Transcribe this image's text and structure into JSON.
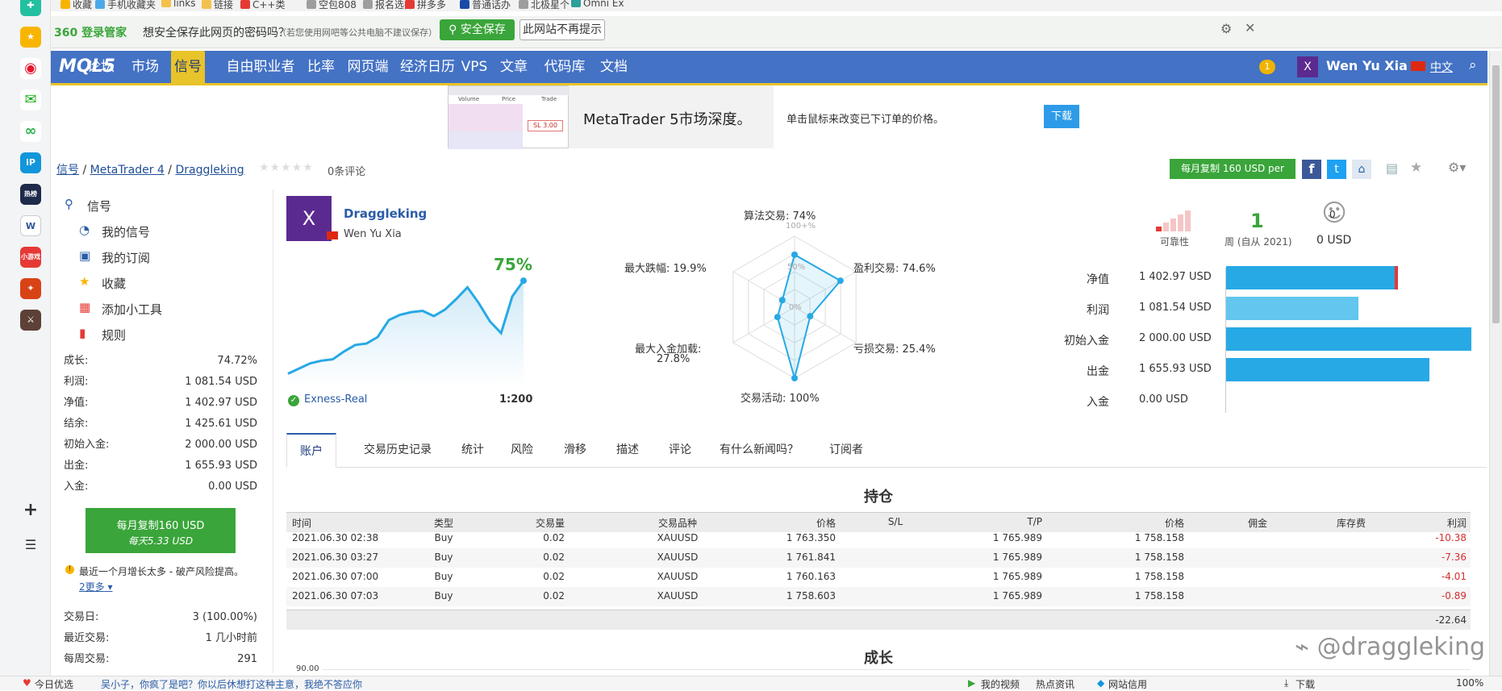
{
  "bookmarks": [
    {
      "label": "收藏",
      "color": "#f6b400"
    },
    {
      "label": "手机收藏夹",
      "color": "#4ba9e8"
    },
    {
      "label": "links",
      "color": "#f3c14b"
    },
    {
      "label": "链接",
      "color": "#f3c14b"
    },
    {
      "label": "C++类",
      "color": "#e53935"
    },
    {
      "label": "空包808",
      "color": "#9e9e9e"
    },
    {
      "label": "报名选择",
      "color": "#9e9e9e"
    },
    {
      "label": "拼多多",
      "color": "#e53935"
    },
    {
      "label": "普通话办",
      "color": "#1a4aa8"
    },
    {
      "label": "北极星个",
      "color": "#9e9e9e"
    },
    {
      "label": "Omni Ex",
      "color": "#2aa198"
    }
  ],
  "savebar": {
    "brand": "360 登录管家",
    "question": "想安全保存此网页的密码吗？",
    "note": "（若您使用网吧等公共电脑不建议保存）",
    "save_button": "安全保存",
    "never_button": "此网站不再提示"
  },
  "nav": {
    "logo": "MQL5",
    "items": [
      "论坛",
      "市场",
      "信号",
      "自由职业者",
      "比率",
      "网页端",
      "经济日历",
      "VPS",
      "文章",
      "代码库",
      "文档"
    ],
    "active": "信号",
    "badge": "1",
    "avatar": "X",
    "user": "Wen Yu Xia",
    "lang": "中文"
  },
  "banner": {
    "title": "MetaTrader 5市场深度。",
    "desc": "单击鼠标来改变已下订单的价格。",
    "button": "下载",
    "mini_headers": [
      "Volume",
      "Price",
      "Trade"
    ],
    "mini_sl": "SL 3.00"
  },
  "breadcrumb": {
    "a": "信号",
    "b": "MetaTrader 4",
    "c": "Draggleking",
    "reviews": "0条评论"
  },
  "subscribe_button": "每月复制 160 USD per",
  "sidebar": {
    "menu": [
      {
        "label": "信号",
        "icon": "antenna-icon"
      },
      {
        "label": "我的信号",
        "icon": "user-signal-icon"
      },
      {
        "label": "我的订阅",
        "icon": "subscription-icon"
      },
      {
        "label": "收藏",
        "icon": "star-icon"
      },
      {
        "label": "添加小工具",
        "icon": "widgets-icon"
      },
      {
        "label": "规则",
        "icon": "bookmark-icon"
      }
    ],
    "stats1": [
      {
        "k": "成长:",
        "v": "74.72%"
      },
      {
        "k": "利润:",
        "v": "1 081.54 USD"
      },
      {
        "k": "净值:",
        "v": "1 402.97 USD"
      },
      {
        "k": "结余:",
        "v": "1 425.61 USD"
      },
      {
        "k": "初始入金:",
        "v": "2 000.00 USD"
      },
      {
        "k": "出金:",
        "v": "1 655.93 USD"
      },
      {
        "k": "入金:",
        "v": "0.00 USD"
      }
    ],
    "green_button": {
      "line1": "每月复制160 USD",
      "line2": "每天5.33 USD"
    },
    "warning": "最近一个月增长太多 - 破产风险提高。",
    "more": "2更多",
    "stats2": [
      {
        "k": "交易日:",
        "v": "3 (100.00%)"
      },
      {
        "k": "最近交易:",
        "v": "1 几小时前"
      },
      {
        "k": "每周交易:",
        "v": "291"
      }
    ]
  },
  "profile": {
    "avatar": "X",
    "name": "Draggleking",
    "owner": "Wen Yu Xia",
    "growth": "75%",
    "growth_series": [
      4,
      8,
      12,
      14,
      15,
      21,
      26,
      27,
      32,
      45,
      49,
      51,
      52,
      48,
      53,
      61,
      70,
      58,
      44,
      35,
      63,
      75
    ],
    "broker": "Exness-Real",
    "leverage": "1:200"
  },
  "radar": {
    "labels": {
      "top": "算法交易: 74%",
      "top_right": "盈利交易: 74.6%",
      "bottom_right": "亏损交易: 25.4%",
      "bottom": "交易活动: 100%",
      "bottom_left_1": "最大入金加载:",
      "bottom_left_2": "27.8%",
      "top_left": "最大跌幅: 19.9%"
    },
    "ticks": [
      "100+%",
      "50%",
      "0%"
    ],
    "values": [
      74,
      74.6,
      25.4,
      100,
      27.8,
      19.9
    ]
  },
  "reliability": {
    "label": "可靠性",
    "weeks": "1",
    "weeks_label": "周 (自从 2021)",
    "subscribers": "0",
    "subscribers_value": "0 USD"
  },
  "bars": [
    {
      "k": "净值",
      "v": "1 402.97 USD",
      "frac": 0.7,
      "color": "#27a9e5"
    },
    {
      "k": "利润",
      "v": "1 081.54 USD",
      "frac": 0.54,
      "color": "#62c6ee"
    },
    {
      "k": "初始入金",
      "v": "2 000.00 USD",
      "frac": 1.0,
      "color": "#27a9e5"
    },
    {
      "k": "出金",
      "v": "1 655.93 USD",
      "frac": 0.83,
      "color": "#27a9e5"
    },
    {
      "k": "入金",
      "v": "0.00 USD",
      "frac": 0.0,
      "color": "#27a9e5"
    }
  ],
  "tabs": [
    "账户",
    "交易历史记录",
    "统计",
    "风险",
    "滑移",
    "描述",
    "评论",
    "有什么新闻吗？",
    "订阅者"
  ],
  "positions": {
    "title": "持仓",
    "headers": [
      "时间",
      "类型",
      "交易量",
      "交易品种",
      "价格",
      "S/L",
      "T/P",
      "价格",
      "佣金",
      "库存费",
      "利润"
    ],
    "rows": [
      [
        "2021.06.30 02:38",
        "Buy",
        "0.02",
        "XAUUSD",
        "1 763.350",
        "",
        "1 765.989",
        "1 758.158",
        "",
        "",
        "-10.38"
      ],
      [
        "2021.06.30 03:27",
        "Buy",
        "0.02",
        "XAUUSD",
        "1 761.841",
        "",
        "1 765.989",
        "1 758.158",
        "",
        "",
        "-7.36"
      ],
      [
        "2021.06.30 07:00",
        "Buy",
        "0.02",
        "XAUUSD",
        "1 760.163",
        "",
        "1 765.989",
        "1 758.158",
        "",
        "",
        "-4.01"
      ],
      [
        "2021.06.30 07:03",
        "Buy",
        "0.02",
        "XAUUSD",
        "1 758.603",
        "",
        "1 765.989",
        "1 758.158",
        "",
        "",
        "-0.89"
      ]
    ],
    "total": "-22.64"
  },
  "growth_section": {
    "title": "成长",
    "axis_top": "90.00"
  },
  "watermark": "@draggleking",
  "statusbar": {
    "left1": "今日优选",
    "news": "吴小子，你疯了是吧？你以后休想打这种主意，我绝不答应你",
    "items": [
      "我的视频",
      "热点资讯",
      "网站信用",
      "下载",
      "100%"
    ]
  }
}
